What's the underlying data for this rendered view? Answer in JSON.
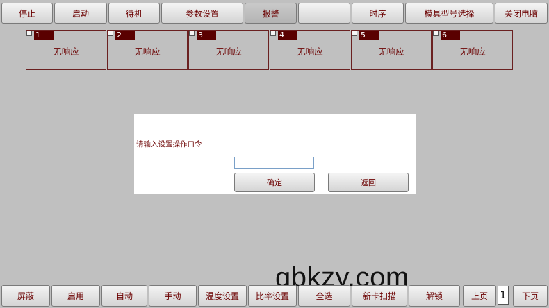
{
  "top_toolbar": {
    "stop": "停止",
    "start": "启动",
    "standby": "待机",
    "params": "参数设置",
    "alarm": "报警",
    "blank": "",
    "timing": "时序",
    "mold_select": "模具型号选择",
    "shutdown": "关闭电脑"
  },
  "zones": [
    {
      "number": "1",
      "status": "无响应"
    },
    {
      "number": "2",
      "status": "无响应"
    },
    {
      "number": "3",
      "status": "无响应"
    },
    {
      "number": "4",
      "status": "无响应"
    },
    {
      "number": "5",
      "status": "无响应"
    },
    {
      "number": "6",
      "status": "无响应"
    }
  ],
  "dialog": {
    "prompt": "请输入设置操作口令",
    "password_value": "",
    "confirm": "确定",
    "back": "返回"
  },
  "bottom_toolbar": {
    "shield": "屏蔽",
    "enable": "启用",
    "auto": "自动",
    "manual": "手动",
    "temp_settings": "温度设置",
    "ratio_settings": "比率设置",
    "select_all": "全选",
    "new_card_scan": "新卡扫描",
    "unlock": "解锁",
    "prev_page": "上页",
    "page_number": "1",
    "next_page": "下页"
  },
  "watermark": "gbkzy.com",
  "colors": {
    "text": "#6b0000",
    "zone_badge": "#5a0000",
    "background": "#c0c0c0"
  }
}
